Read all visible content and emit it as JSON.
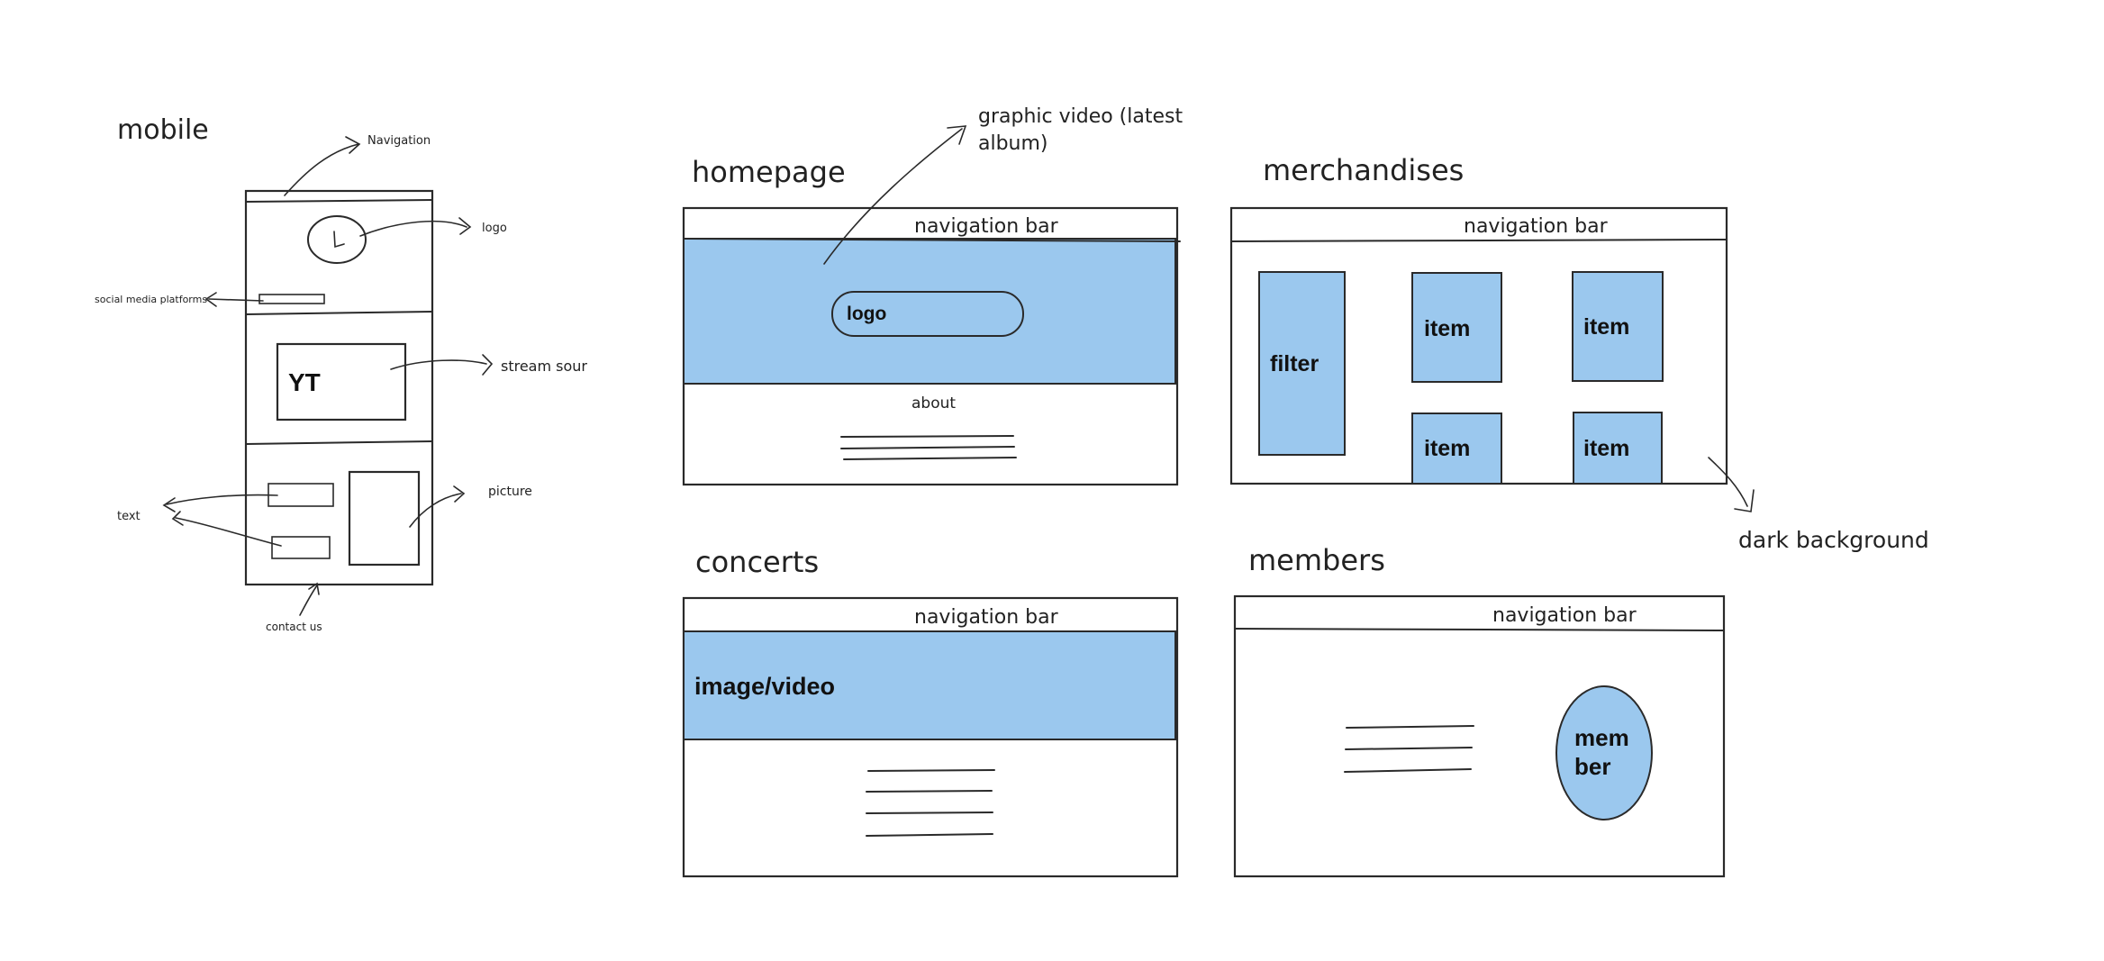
{
  "mobile": {
    "title": "mobile",
    "navigation_label": "Navigation",
    "logo_label": "logo",
    "social_label": "social media platforms",
    "yt_label": "YT",
    "stream_label": "stream sour",
    "picture_label": "picture",
    "text_label": "text",
    "contact_label": "contact us"
  },
  "homepage": {
    "title": "homepage",
    "nav_label": "navigation bar",
    "graphic_note": [
      "graphic video (latest",
      "album)"
    ],
    "logo_label": "logo",
    "about_label": "about"
  },
  "merchandises": {
    "title": "merchandises",
    "nav_label": "navigation bar",
    "filter_label": "filter",
    "items": [
      "item",
      "item",
      "item",
      "item"
    ],
    "bg_note": "dark background"
  },
  "concerts": {
    "title": "concerts",
    "nav_label": "navigation bar",
    "media_label": "image/video"
  },
  "members": {
    "title": "members",
    "nav_label": "navigation bar",
    "member_label": [
      "mem",
      "ber"
    ]
  },
  "colors": {
    "fill_blue": "#9bc8ee",
    "stroke": "#2a2a2a"
  }
}
